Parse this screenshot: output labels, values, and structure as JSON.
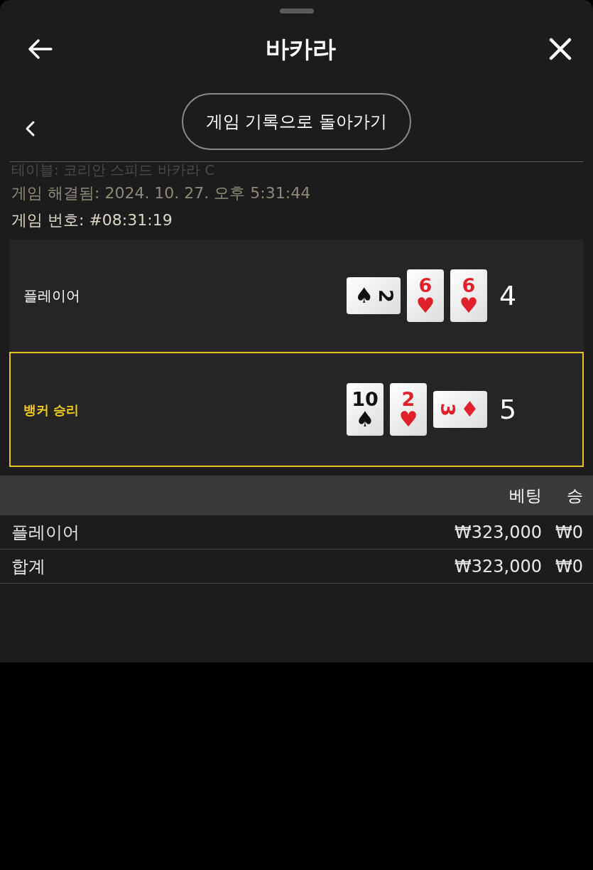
{
  "header": {
    "title": "바카라"
  },
  "back_to_history": {
    "label": "게임 기록으로 돌아가기"
  },
  "info_lines": [
    {
      "kind": "faded",
      "text": "테이블: 코리안 스피드 바카라 C"
    },
    {
      "kind": "dim",
      "text": "게임 해결됨: 2024. 10. 27. 오후 5:31:44"
    },
    {
      "kind": "plain",
      "text": "게임 번호: #08:31:19"
    }
  ],
  "hands": [
    {
      "label": "플레이어",
      "winner": false,
      "total": "4",
      "cards": [
        {
          "rank": "2",
          "suit": "♠",
          "color": "#111111",
          "sideways": true
        },
        {
          "rank": "6",
          "suit": "♥",
          "color": "#e0202a",
          "sideways": false
        },
        {
          "rank": "6",
          "suit": "♥",
          "color": "#e0202a",
          "sideways": false
        }
      ]
    },
    {
      "label": "뱅커 승리",
      "winner": true,
      "total": "5",
      "cards": [
        {
          "rank": "10",
          "suit": "♠",
          "color": "#111111",
          "sideways": false
        },
        {
          "rank": "2",
          "suit": "♥",
          "color": "#e0202a",
          "sideways": false
        },
        {
          "rank": "3",
          "suit": "♦",
          "color": "#e0202a",
          "sideways": true
        }
      ]
    }
  ],
  "table": {
    "columns": [
      "베팅",
      "승"
    ],
    "rows": [
      {
        "label": "플레이어",
        "bet": "₩323,000",
        "win": "₩0"
      },
      {
        "label": "합계",
        "bet": "₩323,000",
        "win": "₩0"
      }
    ]
  }
}
